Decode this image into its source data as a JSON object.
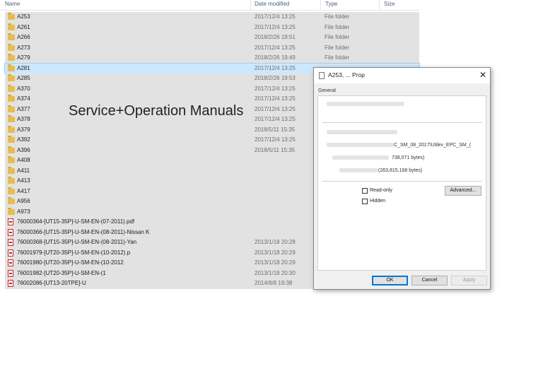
{
  "header": {
    "name": "Name",
    "date_modified": "Date modified",
    "type": "Type",
    "size": "Size"
  },
  "rows": [
    {
      "name": "A253",
      "date": "2017/12/4 13:25",
      "type": "File folder",
      "kind": "folder"
    },
    {
      "name": "A261",
      "date": "2017/12/4 13:25",
      "type": "File folder",
      "kind": "folder"
    },
    {
      "name": "A266",
      "date": "2018/2/26 19:51",
      "type": "File folder",
      "kind": "folder"
    },
    {
      "name": "A273",
      "date": "2017/12/4 13:25",
      "type": "File folder",
      "kind": "folder"
    },
    {
      "name": "A279",
      "date": "2018/2/26 19:49",
      "type": "File folder",
      "kind": "folder"
    },
    {
      "name": "A281",
      "date": "2017/12/4 13:25",
      "type": "",
      "kind": "folder",
      "selected": true
    },
    {
      "name": "A285",
      "date": "2018/2/26 19:53",
      "type": "",
      "kind": "folder"
    },
    {
      "name": "A370",
      "date": "2017/12/4 13:25",
      "type": "",
      "kind": "folder"
    },
    {
      "name": "A374",
      "date": "2017/12/4 13:25",
      "type": "",
      "kind": "folder"
    },
    {
      "name": "A377",
      "date": "2017/12/4 13:25",
      "type": "",
      "kind": "folder"
    },
    {
      "name": "A378",
      "date": "2017/12/4 13:25",
      "type": "",
      "kind": "folder"
    },
    {
      "name": "A379",
      "date": "2018/5/11 15:35",
      "type": "",
      "kind": "folder"
    },
    {
      "name": "A392",
      "date": "2017/12/4 13:25",
      "type": "",
      "kind": "folder"
    },
    {
      "name": "A396",
      "date": "2018/5/11 15:35",
      "type": "",
      "kind": "folder"
    },
    {
      "name": "A408",
      "date": "",
      "type": "",
      "kind": "folder"
    },
    {
      "name": "A411",
      "date": "",
      "type": "",
      "kind": "folder"
    },
    {
      "name": "A413",
      "date": "",
      "type": "",
      "kind": "folder"
    },
    {
      "name": "A417",
      "date": "",
      "type": "",
      "kind": "folder"
    },
    {
      "name": "A956",
      "date": "",
      "type": "",
      "kind": "folder"
    },
    {
      "name": "A973",
      "date": "",
      "type": "",
      "kind": "folder"
    },
    {
      "name": "76000364-[UT15-35P]-U-SM-EN-(07-2011).pdf",
      "date": "",
      "type": "",
      "kind": "pdf"
    },
    {
      "name": "76000366-[UT15-35P]-U-SM-EN-(08-2011)-Nissan K",
      "date": "",
      "type": "",
      "kind": "pdf"
    },
    {
      "name": "76000368-[UT15-35P]-U-SM-EN-(08-2011)-Yan",
      "date": "2013/1/18 20:28",
      "type": "",
      "kind": "pdf"
    },
    {
      "name": "76001979-[UT20-35P]-U-SM-EN-(10-2012).p",
      "date": "2013/1/18 20:29",
      "type": "",
      "kind": "pdf"
    },
    {
      "name": "76001980-[UT20-35P]-U-SM-EN-(10-2012",
      "date": "2013/1/18 20:29",
      "type": "",
      "kind": "pdf"
    },
    {
      "name": "76001982-[UT20-35P]-U-SM-EN-(1",
      "date": "2013/1/18 20:30",
      "type": "",
      "kind": "pdf"
    },
    {
      "name": "76002086-[UT13-20TPE]-U",
      "date": "2014/8/8 19:38",
      "type": "",
      "kind": "pdf"
    }
  ],
  "overlay": {
    "title": "Service+Operation Manuals"
  },
  "dialog": {
    "title": "A253, ... Prop",
    "tab": "General",
    "location_fragment": "C_SM_08_2017\\Utilev_EPC_SM_(",
    "size_fragment": "738,071 bytes)",
    "size_on_disk_fragment": "(263,815,168 bytes)",
    "readonly_label": "Read-only",
    "hidden_label": "Hidden",
    "advanced_label": "Advanced...",
    "ok_label": "OK",
    "cancel_label": "Cancel",
    "apply_label": "Apply",
    "close_glyph": "✕"
  }
}
